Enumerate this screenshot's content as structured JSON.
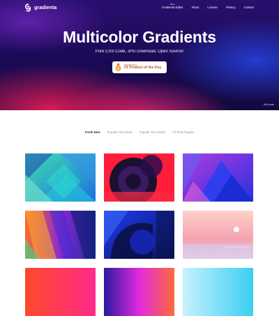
{
  "header": {
    "brand": "gradienta",
    "nav": [
      {
        "label": "Gradienta Editor",
        "badge": "Beta"
      },
      {
        "label": "About"
      },
      {
        "label": "License"
      },
      {
        "label": "Privacy"
      },
      {
        "label": "Contact"
      }
    ]
  },
  "hero": {
    "title": "Multicolor Gradients",
    "subtitle": "Pure CSS Code, JPG Download, Open Source!",
    "badge_small": "Product Hunt",
    "badge_main": "#1 Product of the Day",
    "credit": "Red Leaks"
  },
  "tabs": [
    {
      "label": "Fresh New",
      "active": true
    },
    {
      "label": "Popular This Week",
      "active": false
    },
    {
      "label": "Popular This Month",
      "active": false
    },
    {
      "label": "All Time Popular",
      "active": false
    }
  ],
  "colors": {
    "accent_badge": "#b05b2a",
    "tab_active": "#2b2d42",
    "tab_inactive": "#8d8fa0"
  }
}
